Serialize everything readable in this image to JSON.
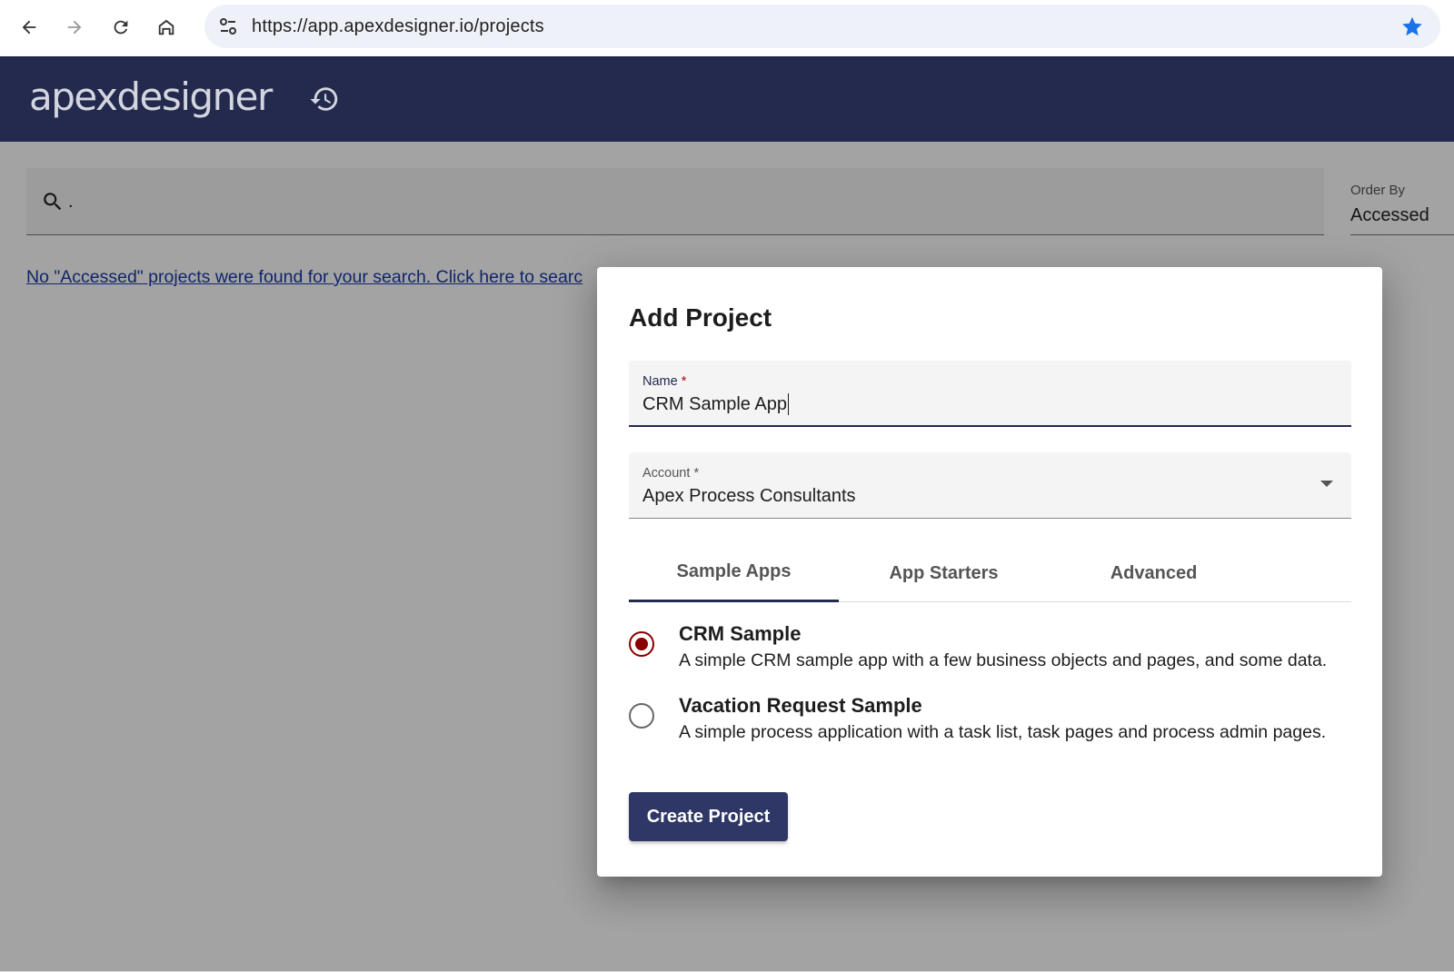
{
  "browser": {
    "url": "https://app.apexdesigner.io/projects",
    "icons": [
      "back-icon",
      "forward-icon",
      "reload-icon",
      "home-icon",
      "site-settings-icon",
      "bookmark-star-icon"
    ]
  },
  "app": {
    "logo_text": "apexdesigner",
    "history_icon": "history-icon"
  },
  "search": {
    "icon": "search-icon",
    "value": ".",
    "order_by_label": "Order By",
    "order_by_value": "Accessed"
  },
  "no_results": {
    "link_text": "No \"Accessed\" projects were found for your search. Click here to searc"
  },
  "dialog": {
    "title": "Add Project",
    "name_field": {
      "label": "Name",
      "required_mark": "*",
      "value": "CRM Sample App"
    },
    "account_field": {
      "label": "Account",
      "required_mark": "*",
      "value": "Apex Process Consultants"
    },
    "tabs": [
      {
        "label": "Sample Apps",
        "active": true
      },
      {
        "label": "App Starters",
        "active": false
      },
      {
        "label": "Advanced",
        "active": false
      }
    ],
    "options": [
      {
        "title": "CRM Sample",
        "description": "A simple CRM sample app with a few business objects and pages, and some data.",
        "selected": true
      },
      {
        "title": "Vacation Request Sample",
        "description": "A simple process application with a task list, task pages and process admin pages.",
        "selected": false
      }
    ],
    "create_button": "Create Project"
  },
  "colors": {
    "header_bg": "#232a4e",
    "primary_button": "#2e3766",
    "radio_selected": "#8b0000",
    "link": "#1a3aa8",
    "bookmark_star": "#1a73e8"
  }
}
